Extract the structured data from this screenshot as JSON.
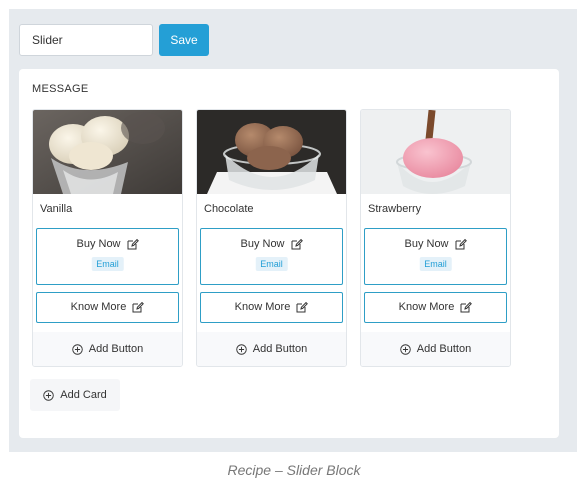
{
  "toolbar": {
    "name_value": "Slider",
    "save_label": "Save"
  },
  "panel": {
    "heading": "MESSAGE",
    "add_card_label": "Add Card"
  },
  "cards": [
    {
      "title": "Vanilla",
      "buttons": [
        {
          "label": "Buy Now",
          "badge": "Email"
        },
        {
          "label": "Know More"
        }
      ],
      "add_button_label": "Add Button"
    },
    {
      "title": "Chocolate",
      "buttons": [
        {
          "label": "Buy Now",
          "badge": "Email"
        },
        {
          "label": "Know More"
        }
      ],
      "add_button_label": "Add Button"
    },
    {
      "title": "Strawberry",
      "buttons": [
        {
          "label": "Buy Now",
          "badge": "Email"
        },
        {
          "label": "Know More"
        }
      ],
      "add_button_label": "Add Button"
    }
  ],
  "caption": "Recipe – Slider Block",
  "colors": {
    "accent": "#249fd6",
    "button_border": "#2e9ec6",
    "frame_bg": "#e6eaee"
  }
}
